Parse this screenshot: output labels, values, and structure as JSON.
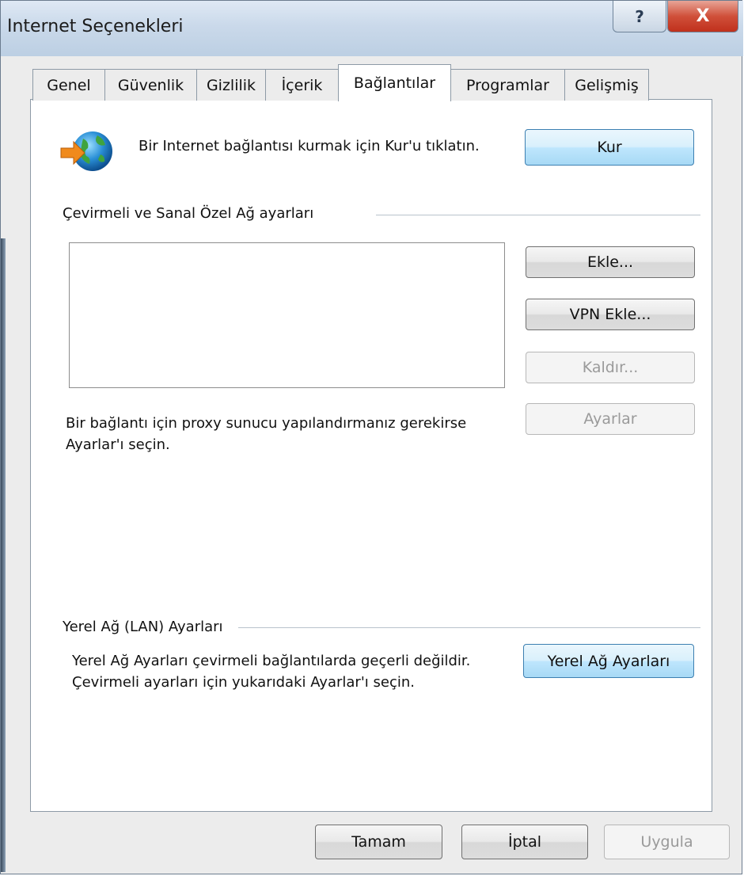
{
  "window": {
    "title": "Internet Seçenekleri",
    "help_glyph": "?",
    "close_glyph": "X"
  },
  "tabs": [
    {
      "label": "Genel",
      "active": false
    },
    {
      "label": "Güvenlik",
      "active": false
    },
    {
      "label": "Gizlilik",
      "active": false
    },
    {
      "label": "İçerik",
      "active": false
    },
    {
      "label": "Bağlantılar",
      "active": true
    },
    {
      "label": "Programlar",
      "active": false
    },
    {
      "label": "Gelişmiş",
      "active": false
    }
  ],
  "setup": {
    "icon": "globe-arrow-icon",
    "text": "Bir Internet bağlantısı kurmak için Kur'u tıklatın.",
    "button": "Kur"
  },
  "dialup": {
    "heading": "Çevirmeli ve Sanal Özel Ağ ayarları",
    "add_button": "Ekle...",
    "add_vpn_button": "VPN Ekle...",
    "remove_button": "Kaldır...",
    "settings_button": "Ayarlar",
    "proxy_text": "Bir bağlantı için proxy sunucu yapılandırmanız gerekirse Ayarlar'ı seçin."
  },
  "lan": {
    "heading": "Yerel Ağ (LAN) Ayarları",
    "text": "Yerel Ağ Ayarları çevirmeli bağlantılarda geçerli değildir. Çevirmeli ayarları için yukarıdaki Ayarlar'ı seçin.",
    "button": "Yerel Ağ Ayarları"
  },
  "footer": {
    "ok_button": "Tamam",
    "cancel_button": "İptal",
    "apply_button": "Uygula"
  },
  "colors": {
    "accent": "#3c7fb1",
    "close": "#c0301c",
    "disabled_text": "#9a9a9a"
  }
}
